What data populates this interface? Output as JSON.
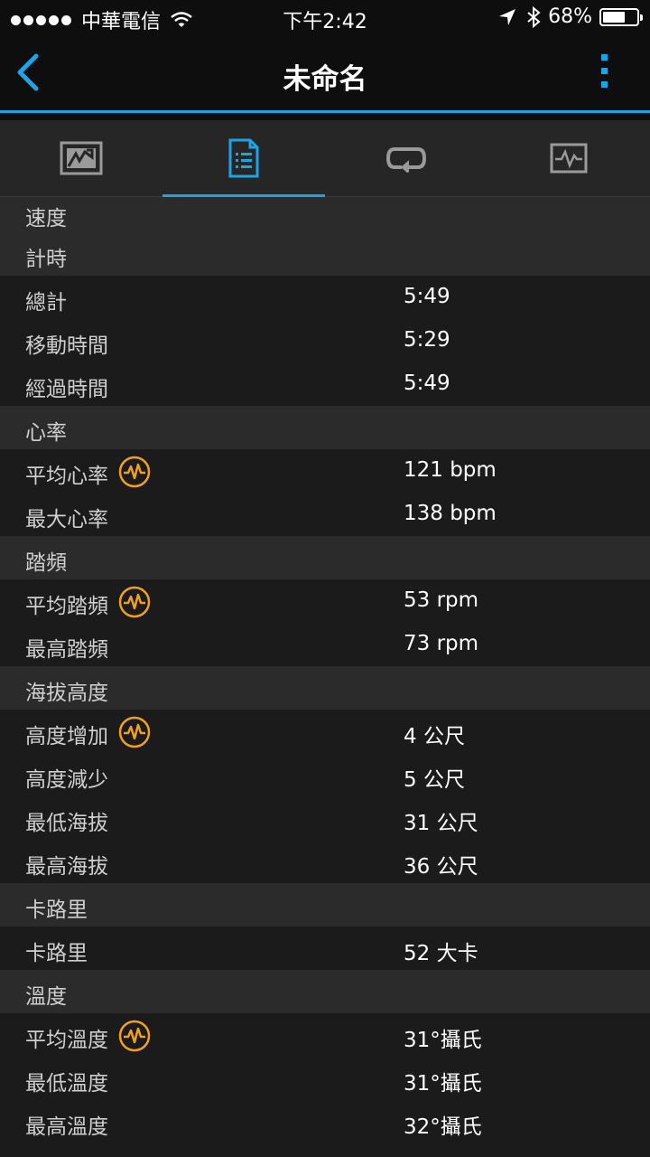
{
  "status_bar": {
    "carrier": "中華電信",
    "time": "下午2:42",
    "battery": "68%",
    "battery_level": 0.68
  },
  "nav": {
    "title": "未命名"
  },
  "tabs": [
    {
      "icon": "map-icon",
      "active": false
    },
    {
      "icon": "details-icon",
      "active": true
    },
    {
      "icon": "laps-icon",
      "active": false
    },
    {
      "icon": "chart-icon",
      "active": false
    }
  ],
  "sections": [
    {
      "header": "速度",
      "items": []
    },
    {
      "header": "計時",
      "items": [
        {
          "label": "總計",
          "value": "5:49",
          "icon": false
        },
        {
          "label": "移動時間",
          "value": "5:29",
          "icon": false
        },
        {
          "label": "經過時間",
          "value": "5:49",
          "icon": false
        }
      ]
    },
    {
      "header": "心率",
      "items": [
        {
          "label": "平均心率",
          "value": "121 bpm",
          "icon": true
        },
        {
          "label": "最大心率",
          "value": "138 bpm",
          "icon": false
        }
      ]
    },
    {
      "header": "踏頻",
      "items": [
        {
          "label": "平均踏頻",
          "value": "53 rpm",
          "icon": true
        },
        {
          "label": "最高踏頻",
          "value": "73 rpm",
          "icon": false
        }
      ]
    },
    {
      "header": "海拔高度",
      "items": [
        {
          "label": "高度增加",
          "value": "4 公尺",
          "icon": true
        },
        {
          "label": "高度減少",
          "value": "5 公尺",
          "icon": false
        },
        {
          "label": "最低海拔",
          "value": "31 公尺",
          "icon": false
        },
        {
          "label": "最高海拔",
          "value": "36 公尺",
          "icon": false
        }
      ]
    },
    {
      "header": "卡路里",
      "items": [
        {
          "label": "卡路里",
          "value": "52 大卡",
          "icon": false
        }
      ]
    },
    {
      "header": "溫度",
      "items": [
        {
          "label": "平均溫度",
          "value": "31°攝氏",
          "icon": true
        },
        {
          "label": "最低溫度",
          "value": "31°攝氏",
          "icon": false
        },
        {
          "label": "最高溫度",
          "value": "32°攝氏",
          "icon": false
        }
      ]
    }
  ],
  "colors": {
    "accent": "#1ba4e6",
    "icon_orange": "#f0a020",
    "header_bg": "#2b2b2b",
    "row_bg": "#1b1b1b"
  }
}
